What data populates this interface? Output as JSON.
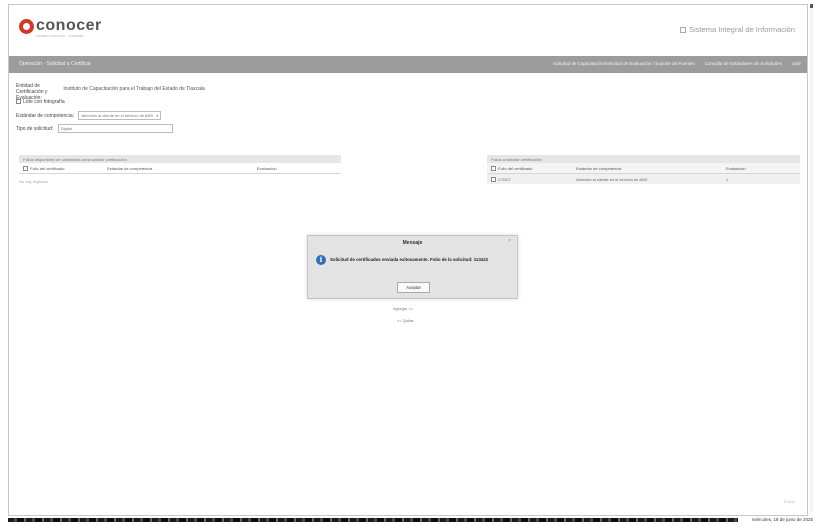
{
  "header": {
    "logo_text": "conocer",
    "logo_subtitle": "CONSEJO NACIONAL · CONOCER",
    "system_title": "Sistema Integral de Información"
  },
  "navbar": {
    "left_label": "Operación · Solicitud a Certificar",
    "right_items": [
      "Solicitud de Capacitación/Solicitud de Evaluación / Soporte de Fuentes",
      "Consulta de Estándares de Solicitudes",
      "Salir"
    ]
  },
  "form": {
    "entity_label": "Entidad de Certificación y Evaluación:",
    "entity_value": "Instituto de Capacitación para el Trabajo del Estado de Tlaxcala",
    "lote_label": "Lote con fotografía",
    "standard_label": "Estándar de competencia:",
    "standard_value": "Atención al cliente en el servicio de ANS",
    "request_type_label": "Tipo de solicitud:",
    "request_type_value": "Digital"
  },
  "left_table": {
    "title": "Folios disponibles de candidatos para solicitar certificación",
    "columns": [
      "Folio del certificado",
      "Estándar de competencia",
      "Evaluación"
    ],
    "empty_message": "No hay registros"
  },
  "right_table": {
    "title": "Folios a solicitar certificación",
    "columns": [
      "Folio del certificado",
      "Estándar de competencia",
      "Evaluación"
    ],
    "rows": [
      [
        "CTD07",
        "Atención al cliente en el servicio de ANS",
        "1"
      ]
    ]
  },
  "middle_buttons": {
    "add": "Agregar >>",
    "remove": "<< Quitar"
  },
  "modal": {
    "title": "Mensaje",
    "close_glyph": "×",
    "info_glyph": "i",
    "message": "Solicitud de certificados enviada exitosamente. Folio de la solicitud: 113422",
    "ok_button": "Aceptar"
  },
  "footer": {
    "right_label": "Enviar"
  },
  "taskbar": {
    "date": "miércoles, 18 de junio de 2025"
  },
  "colors": {
    "logo_red": "#d13a2a",
    "navbar_gray": "#9c9c9c",
    "info_blue": "#2f6fb7"
  }
}
